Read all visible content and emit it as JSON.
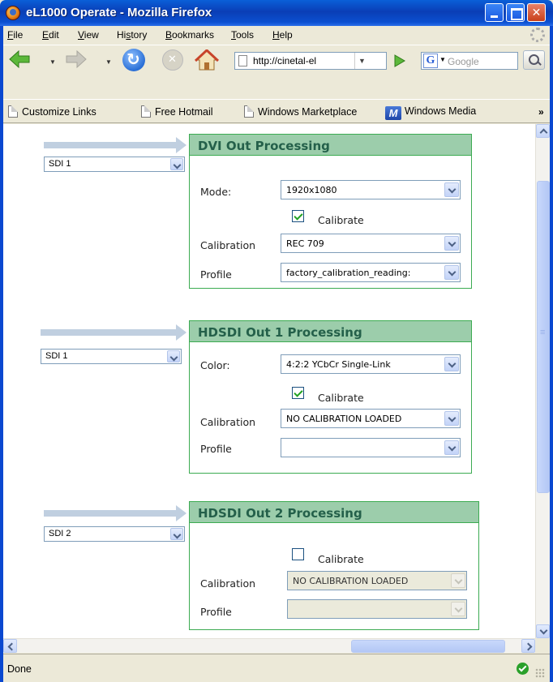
{
  "window": {
    "title": "eL1000 Operate - Mozilla Firefox"
  },
  "menu": {
    "file": "File",
    "edit": "Edit",
    "view": "View",
    "history": "History",
    "bookmarks": "Bookmarks",
    "tools": "Tools",
    "help": "Help"
  },
  "nav": {
    "url": "http://cinetal-el",
    "search_placeholder": "Google",
    "search_engine_letter": "G"
  },
  "bookmarks": {
    "items": [
      "Customize Links",
      "Free Hotmail",
      "Windows Marketplace",
      "Windows Media"
    ],
    "more": "»",
    "windows_media_icon_letter": "M"
  },
  "panels": [
    {
      "title": "DVI Out Processing",
      "source": "SDI 1",
      "mode_label": "Mode:",
      "mode_value": "1920x1080",
      "calibrate_label": "Calibrate",
      "calibrate_checked": true,
      "calibration_label": "Calibration",
      "calibration_value": "REC 709",
      "profile_label": "Profile",
      "profile_value": "factory_calibration_reading:"
    },
    {
      "title": "HDSDI Out 1 Processing",
      "source": "SDI 1",
      "color_label": "Color:",
      "color_value": "4:2:2 YCbCr Single-Link",
      "calibrate_label": "Calibrate",
      "calibrate_checked": true,
      "calibration_label": "Calibration",
      "calibration_value": "NO CALIBRATION LOADED",
      "profile_label": "Profile",
      "profile_value": ""
    },
    {
      "title": "HDSDI Out 2 Processing",
      "source": "SDI 2",
      "calibrate_label": "Calibrate",
      "calibrate_checked": false,
      "calibration_label": "Calibration",
      "calibration_value": "NO CALIBRATION LOADED",
      "profile_label": "Profile",
      "profile_value": ""
    }
  ],
  "status": {
    "text": "Done"
  },
  "colors": {
    "panel_header": "#9ccdab",
    "panel_border": "#3cab52",
    "panel_title": "#24604a",
    "arrow": "#c0cfe0"
  }
}
